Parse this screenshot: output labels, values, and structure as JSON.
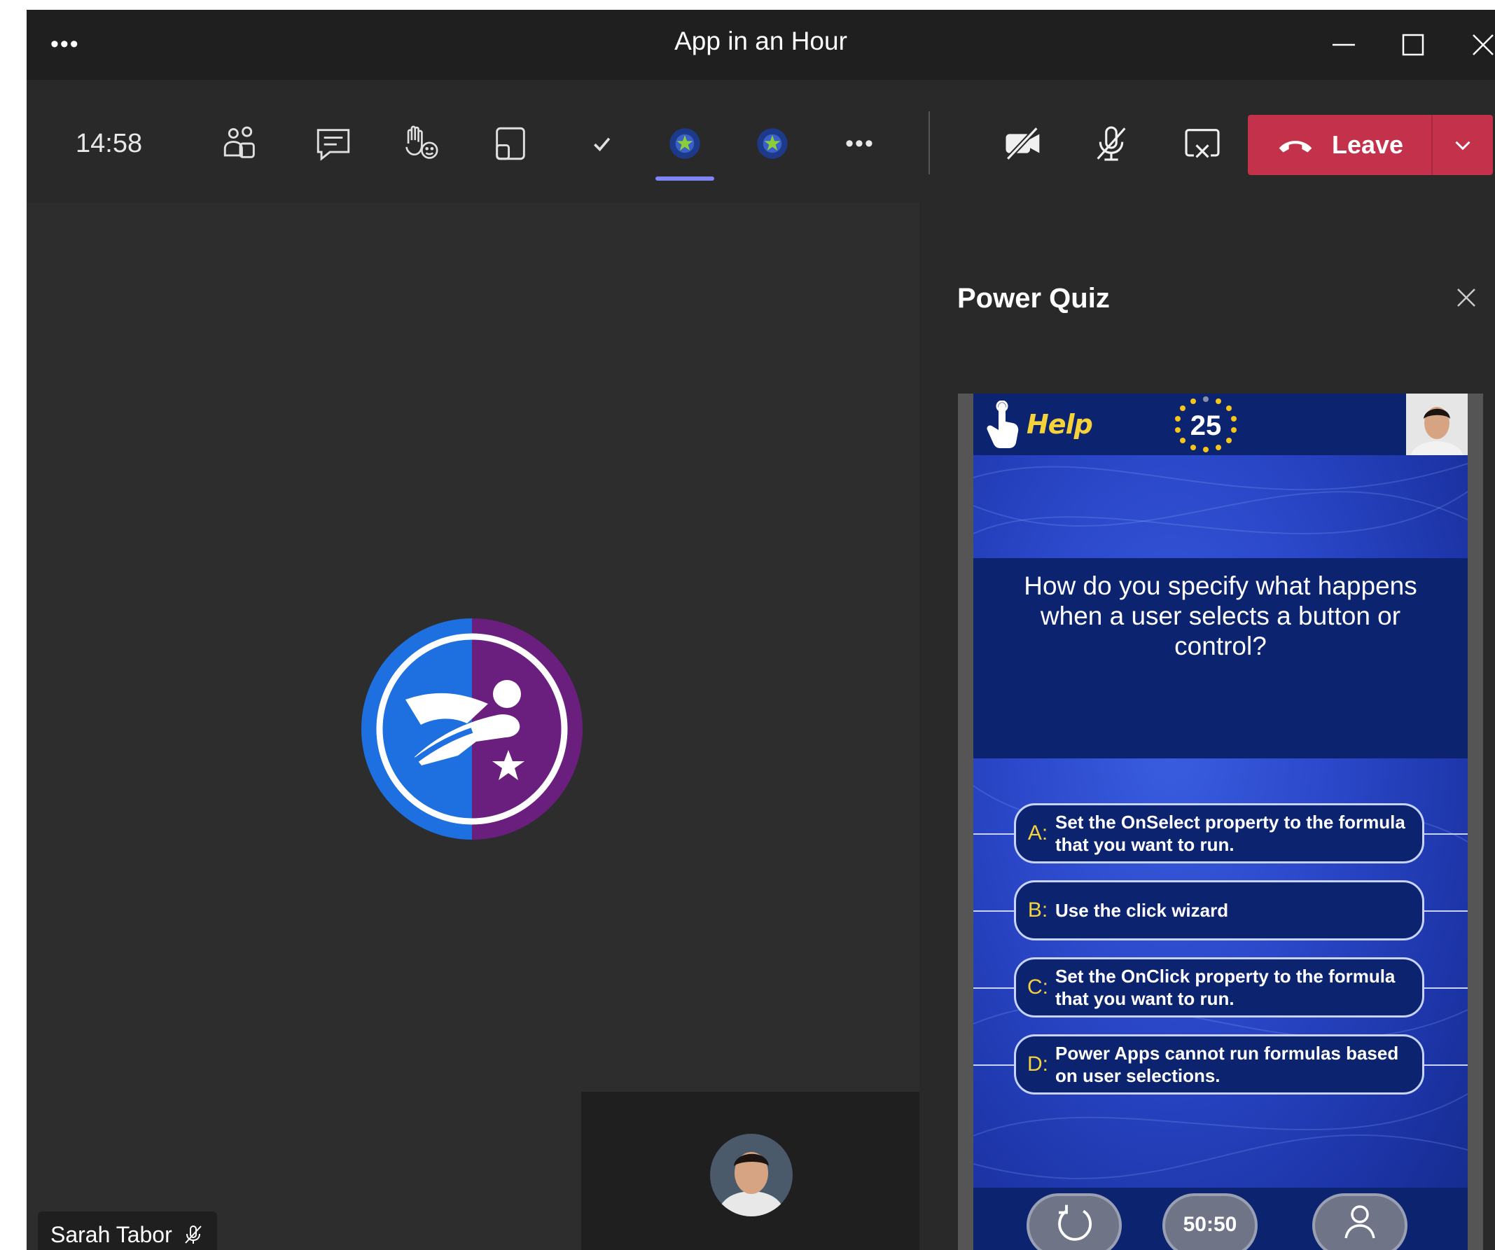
{
  "window": {
    "title": "App in an Hour",
    "more": "•••"
  },
  "toolbar": {
    "clock": "14:58",
    "leave_label": "Leave",
    "more": "•••"
  },
  "stage": {
    "participant_name": "Sarah Tabor"
  },
  "panel": {
    "title": "Power Quiz"
  },
  "quiz": {
    "help_label": "Help",
    "timer": "25",
    "question": "How do you specify what happens when a user selects a button or control?",
    "answers": [
      {
        "letter": "A:",
        "text": "Set the OnSelect property to the formula that you want to run."
      },
      {
        "letter": "B:",
        "text": "Use the click wizard"
      },
      {
        "letter": "C:",
        "text": "Set the OnClick property to the formula that you want to run."
      },
      {
        "letter": "D:",
        "text": "Power Apps cannot run formulas based on user selections."
      }
    ],
    "lifeline_fifty": "50:50"
  },
  "colors": {
    "leave": "#c4314b",
    "accent": "#7f85f5",
    "quiz_navy": "#0c2370",
    "answer_letter": "#f5d23a"
  }
}
